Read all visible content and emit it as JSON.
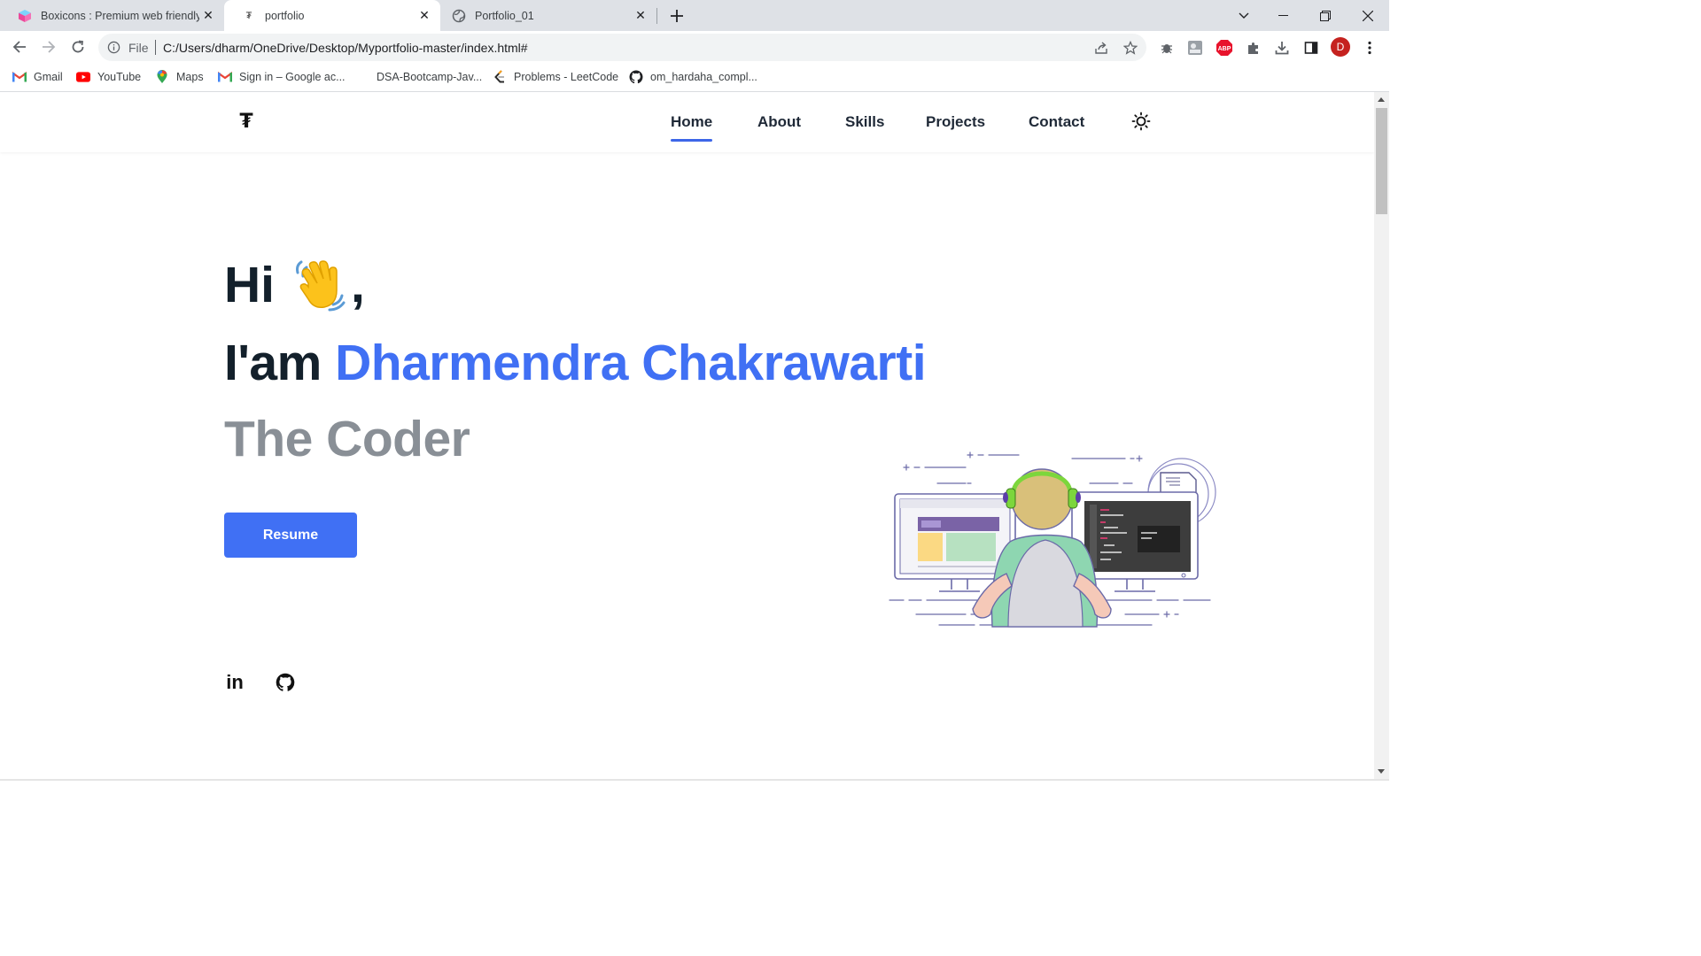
{
  "browser": {
    "tabs": [
      {
        "title": "Boxicons : Premium web friendly",
        "active": false,
        "icon": "boxicons-logo-icon"
      },
      {
        "title": "portfolio",
        "active": true,
        "icon": "portfolio-favicon-icon"
      },
      {
        "title": "Portfolio_01",
        "active": false,
        "icon": "globe-icon"
      }
    ],
    "address": {
      "scheme_label": "File",
      "url": "C:/Users/dharm/OneDrive/Desktop/Myportfolio-master/index.html#"
    },
    "profile_initial": "D",
    "extension_badge": "ABP",
    "bookmarks": [
      {
        "label": "Gmail",
        "icon": "gmail-icon"
      },
      {
        "label": "YouTube",
        "icon": "youtube-icon"
      },
      {
        "label": "Maps",
        "icon": "maps-icon"
      },
      {
        "label": "Sign in – Google ac...",
        "icon": "gmail-icon"
      },
      {
        "label": "DSA-Bootcamp-Jav...",
        "icon": ""
      },
      {
        "label": "Problems - LeetCode",
        "icon": "leetcode-icon"
      },
      {
        "label": "om_hardaha_compl...",
        "icon": "github-icon"
      }
    ]
  },
  "site": {
    "logo": "₮",
    "nav": [
      {
        "label": "Home",
        "active": true
      },
      {
        "label": "About",
        "active": false
      },
      {
        "label": "Skills",
        "active": false
      },
      {
        "label": "Projects",
        "active": false
      },
      {
        "label": "Contact",
        "active": false
      }
    ],
    "hero": {
      "greeting": "Hi",
      "greeting_suffix": ",",
      "intro": "I'am",
      "name": "Dharmendra Chakrawarti",
      "role": "The Coder",
      "resume_label": "Resume"
    },
    "social": [
      {
        "label": "in",
        "icon": "linkedin-icon"
      },
      {
        "label": "",
        "icon": "github-icon"
      }
    ],
    "illustration_code_label": "</>"
  },
  "colors": {
    "accent": "#4070f4",
    "heading": "#13202b",
    "muted": "#898f96",
    "tabstrip": "#dee1e6"
  }
}
